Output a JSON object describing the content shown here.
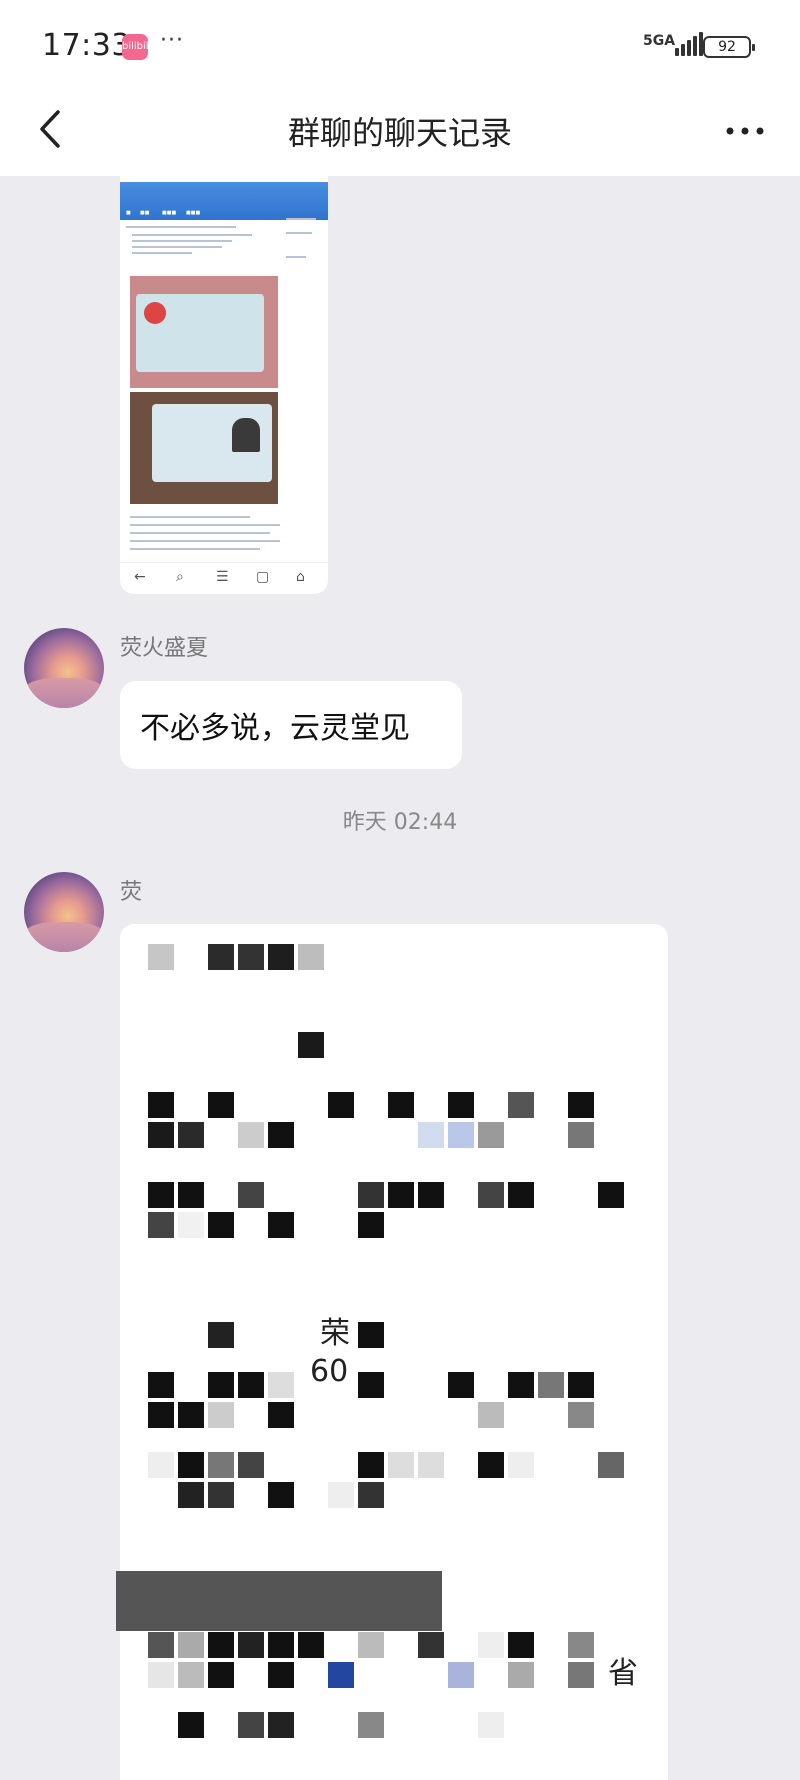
{
  "status_bar": {
    "time": "17:33",
    "app_badge": "bilibili",
    "dots": "···",
    "network": "5GA",
    "battery": "92"
  },
  "nav": {
    "title": "群聊的聊天记录"
  },
  "messages": [
    {
      "sender": "荧火盛夏",
      "text": "不必多说，云灵堂见"
    },
    {
      "sender": "荧"
    }
  ],
  "timestamp": "昨天 02:44",
  "image_fragments": [
    "荣",
    "60",
    "省"
  ],
  "icons": {
    "back": "chevron-left-icon",
    "menu": "more-horizontal-icon"
  },
  "colors": {
    "background": "#ececf0",
    "bubble": "#ffffff",
    "badge": "#f2688e"
  }
}
